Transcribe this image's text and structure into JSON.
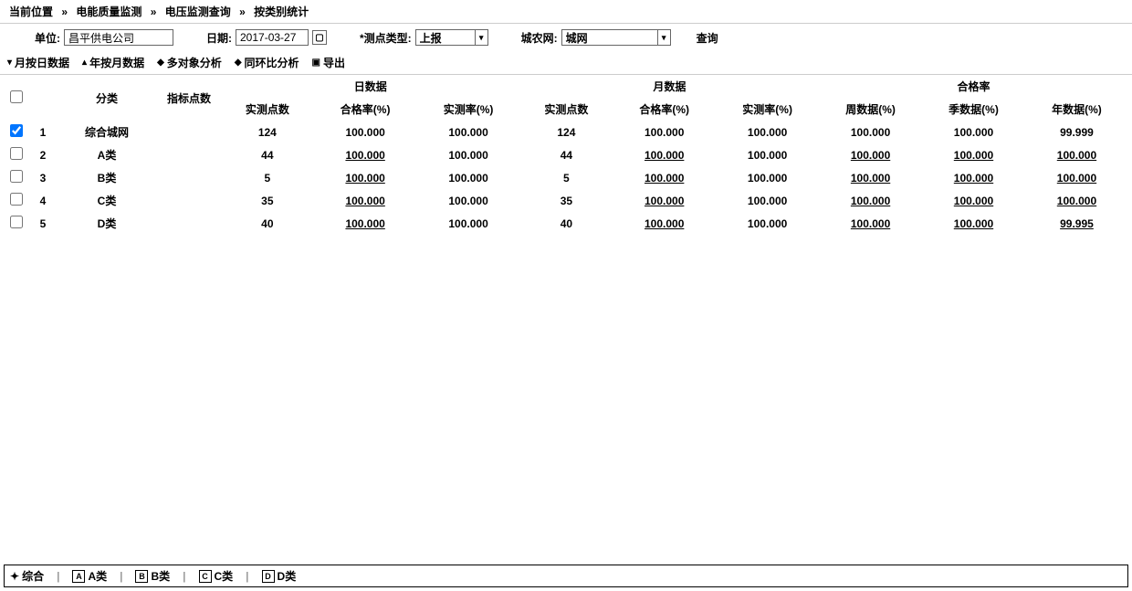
{
  "breadcrumb": {
    "label0": "当前位置",
    "sep": "»",
    "label1": "电能质量监测",
    "label2": "电压监测查询",
    "label3": "按类别统计"
  },
  "filters": {
    "unit_label": "单位:",
    "unit_value": "昌平供电公司",
    "date_label": "日期:",
    "date_value": "2017-03-27",
    "mtype_label": "*测点类型:",
    "mtype_value": "上报",
    "grid_label": "城农网:",
    "grid_value": "城网",
    "query_label": "查询"
  },
  "toolbar": {
    "t1": "月按日数据",
    "t2": "年按月数据",
    "t3": "多对象分析",
    "t4": "同环比分析",
    "t5": "导出"
  },
  "table": {
    "h_category": "分类",
    "h_indicator": "指标点数",
    "h_day_group": "日数据",
    "h_month_group": "月数据",
    "h_pass_group": "合格率",
    "h_real_points": "实测点数",
    "h_pass_rate": "合格率(%)",
    "h_real_rate": "实测率(%)",
    "h_week": "周数据(%)",
    "h_season": "季数据(%)",
    "h_year": "年数据(%)",
    "rows": [
      {
        "idx": "1",
        "cat": "综合城网",
        "ind": "",
        "d_pts": "124",
        "d_pass": "100.000",
        "d_real": "100.000",
        "m_pts": "124",
        "m_pass": "100.000",
        "m_real": "100.000",
        "week": "100.000",
        "season": "100.000",
        "year": "99.999",
        "checked": true,
        "link": false
      },
      {
        "idx": "2",
        "cat": "A类",
        "ind": "",
        "d_pts": "44",
        "d_pass": "100.000",
        "d_real": "100.000",
        "m_pts": "44",
        "m_pass": "100.000",
        "m_real": "100.000",
        "week": "100.000",
        "season": "100.000",
        "year": "100.000",
        "checked": false,
        "link": true
      },
      {
        "idx": "3",
        "cat": "B类",
        "ind": "",
        "d_pts": "5",
        "d_pass": "100.000",
        "d_real": "100.000",
        "m_pts": "5",
        "m_pass": "100.000",
        "m_real": "100.000",
        "week": "100.000",
        "season": "100.000",
        "year": "100.000",
        "checked": false,
        "link": true
      },
      {
        "idx": "4",
        "cat": "C类",
        "ind": "",
        "d_pts": "35",
        "d_pass": "100.000",
        "d_real": "100.000",
        "m_pts": "35",
        "m_pass": "100.000",
        "m_real": "100.000",
        "week": "100.000",
        "season": "100.000",
        "year": "100.000",
        "checked": false,
        "link": true
      },
      {
        "idx": "5",
        "cat": "D类",
        "ind": "",
        "d_pts": "40",
        "d_pass": "100.000",
        "d_real": "100.000",
        "m_pts": "40",
        "m_pass": "100.000",
        "m_real": "100.000",
        "week": "100.000",
        "season": "100.000",
        "year": "99.995",
        "checked": false,
        "link": true
      }
    ]
  },
  "bottom_tabs": {
    "t0": "综合",
    "t1": "A类",
    "t2": "B类",
    "t3": "C类",
    "t4": "D类"
  }
}
